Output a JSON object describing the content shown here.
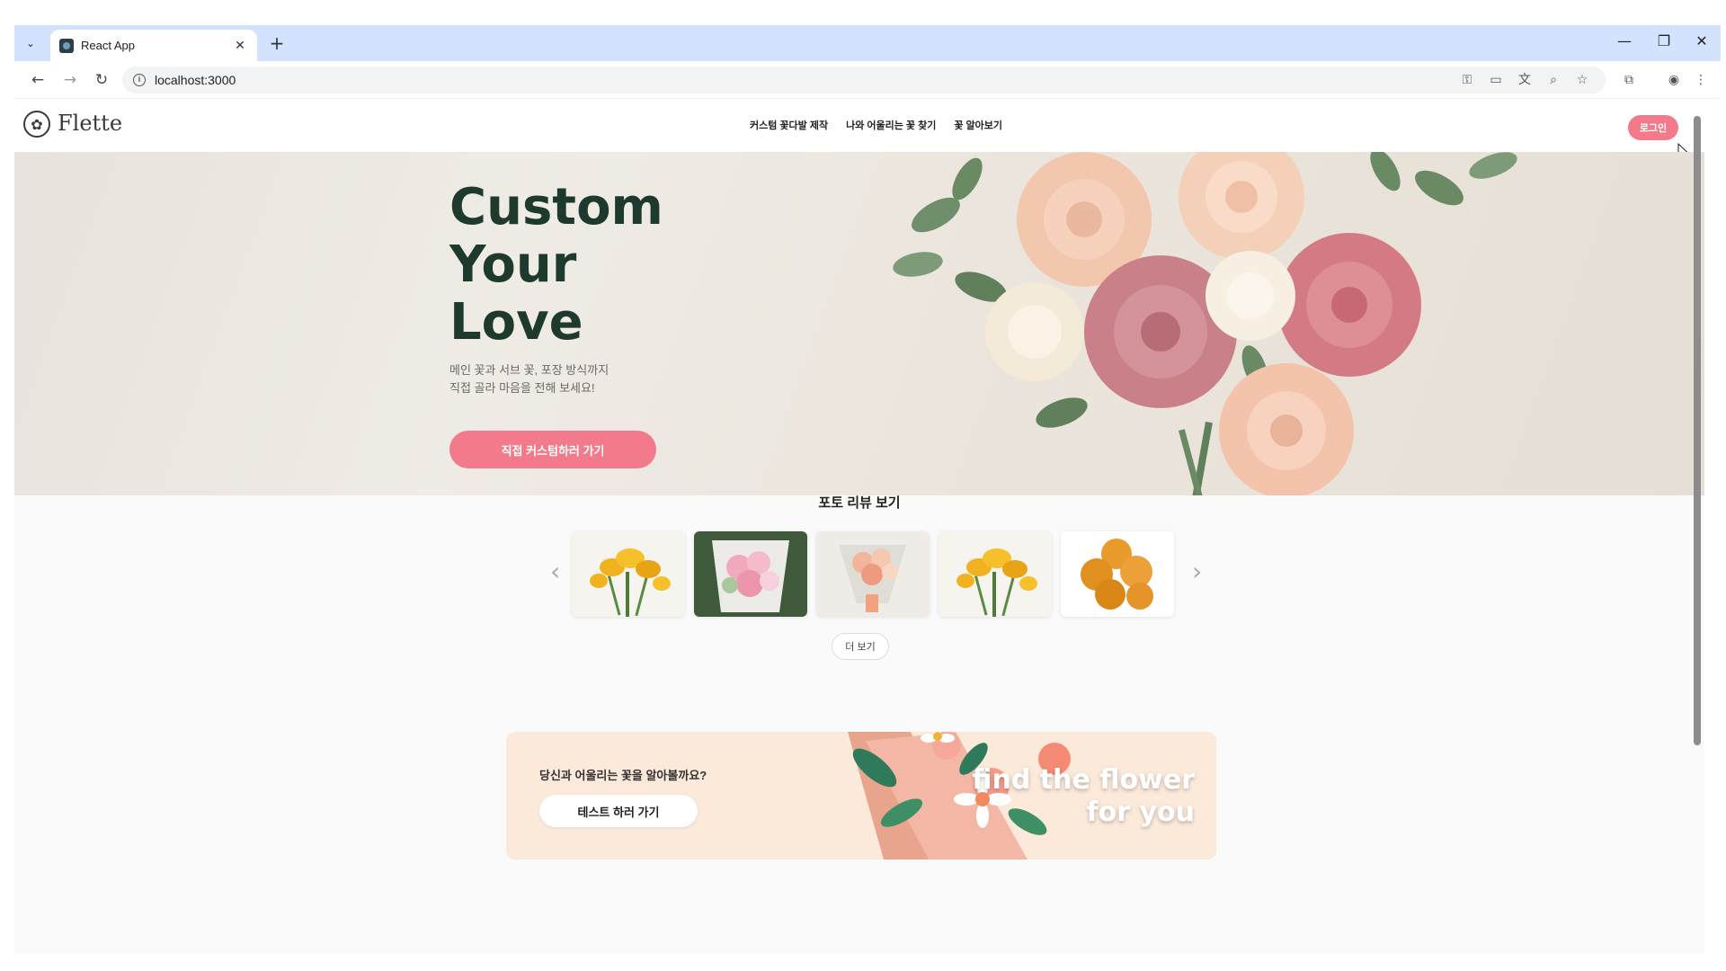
{
  "browser": {
    "tab_title": "React App",
    "url": "localhost:3000",
    "new_tab": "+",
    "tab_close": "✕",
    "tab_list": "⌄"
  },
  "site": {
    "logo_text": "Flette",
    "nav": [
      "커스텀 꽃다발 제작",
      "나와 어울리는 꽃 찾기",
      "꽃 알아보기"
    ],
    "login_label": "로그인"
  },
  "hero": {
    "title_lines": [
      "Custom",
      "Your",
      "Love"
    ],
    "subtitle_lines": [
      "메인 꽃과 서브 꽃, 포장 방식까지",
      "직접 골라 마음을 전해 보세요!"
    ],
    "cta_label": "직접 커스텀하러 가기"
  },
  "reviews": {
    "title": "포토 리뷰 보기",
    "more_label": "더 보기",
    "prev": "‹",
    "next": "›",
    "photos": [
      "yellow-freesia",
      "pink-bouquet",
      "peach-bouquet",
      "yellow-freesia",
      "orange-pumpkins"
    ]
  },
  "test_banner": {
    "question": "당신과 어울리는 꽃을 알아볼까요?",
    "button_label": "테스트 하러 가기",
    "art_text_line1": "find the flower",
    "art_text_line2": "for you"
  },
  "colors": {
    "accent": "#f27a8a",
    "hero_title": "#1e3a2e",
    "banner_bg": "#fbe9da"
  }
}
